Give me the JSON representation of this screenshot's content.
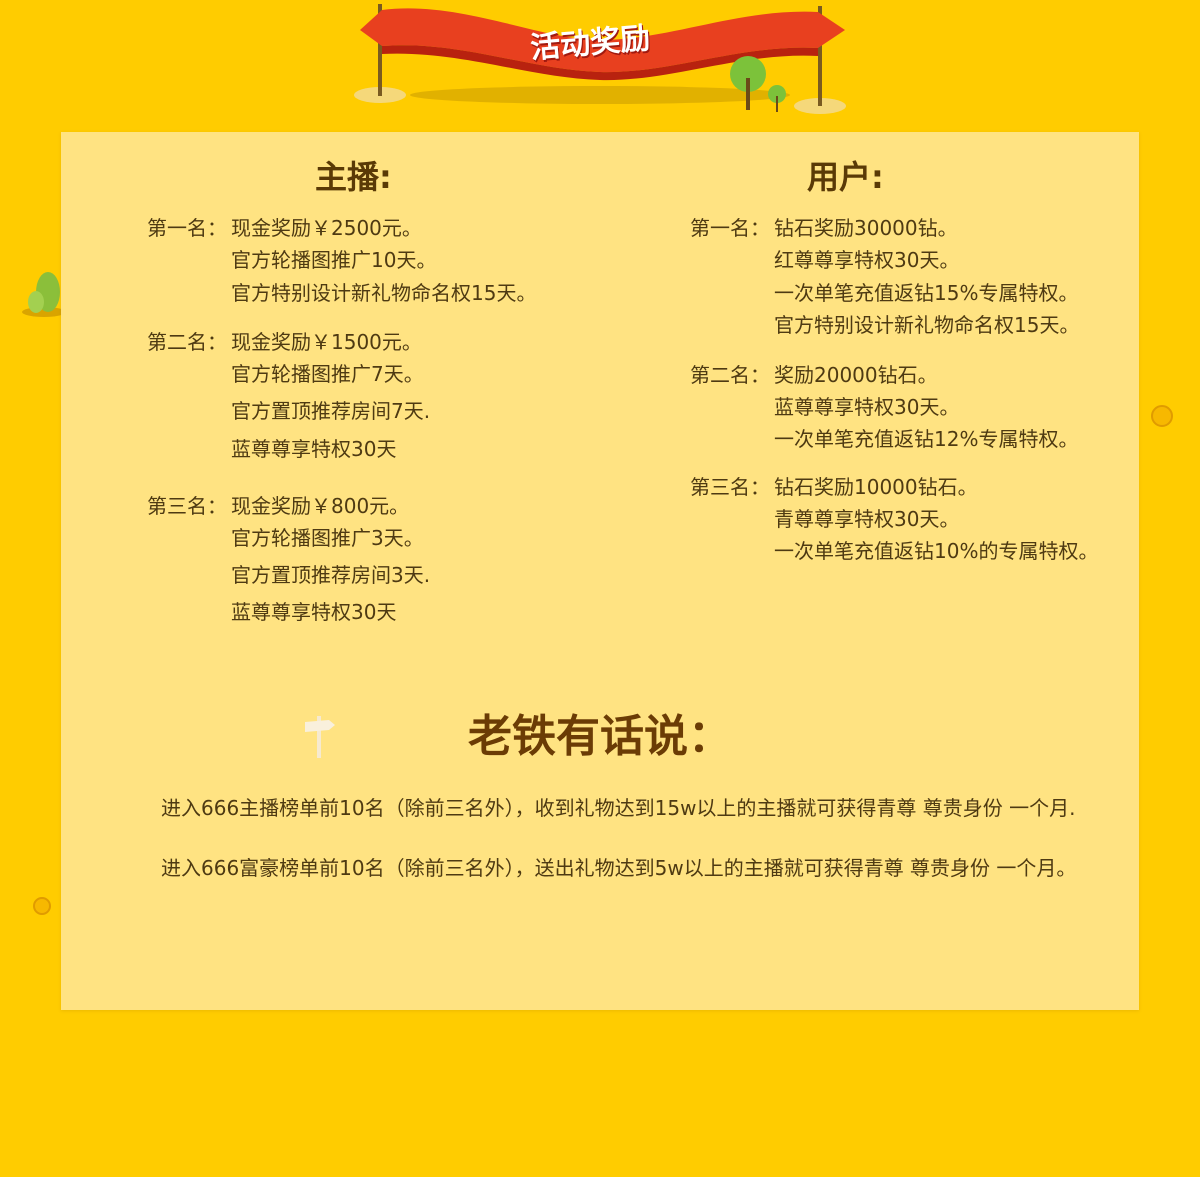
{
  "banner": {
    "title": "活动奖励",
    "colors": {
      "ribbon": "#e8401f",
      "ribbon_dark": "#b8220f",
      "pole": "#7a5a20",
      "tree": "#7cc23a"
    }
  },
  "anchor": {
    "heading": "主播:",
    "ranks": [
      {
        "label": "第一名：",
        "items": [
          "现金奖励￥2500元。",
          "官方轮播图推广10天。",
          "官方特别设计新礼物命名权15天。"
        ]
      },
      {
        "label": "第二名：",
        "items": [
          "现金奖励￥1500元。",
          "官方轮播图推广7天。",
          "官方置顶推荐房间7天.",
          "蓝尊尊享特权30天"
        ]
      },
      {
        "label": "第三名：",
        "items": [
          "现金奖励￥800元。",
          "官方轮播图推广3天。",
          "官方置顶推荐房间3天.",
          "蓝尊尊享特权30天"
        ]
      }
    ]
  },
  "user": {
    "heading": "用户:",
    "ranks": [
      {
        "label": "第一名：",
        "items": [
          "钻石奖励30000钻。",
          "红尊尊享特权30天。",
          "一次单笔充值返钻15%专属特权。",
          "官方特别设计新礼物命名权15天。"
        ]
      },
      {
        "label": "第二名：",
        "items": [
          "奖励20000钻石。",
          "蓝尊尊享特权30天。",
          "一次单笔充值返钻12%专属特权。"
        ]
      },
      {
        "label": "第三名：",
        "items": [
          "钻石奖励10000钻石。",
          "青尊尊享特权30天。",
          "一次单笔充值返钻10%的专属特权。"
        ]
      }
    ]
  },
  "notes": {
    "heading": "老铁有话说：",
    "lines": [
      "进入666主播榜单前10名（除前三名外），收到礼物达到15w以上的主播就可获得青尊 尊贵身份 一个月.",
      "进入666富豪榜单前10名（除前三名外），送出礼物达到5w以上的主播就可获得青尊 尊贵身份 一个月。"
    ]
  },
  "colors": {
    "background": "#ffcc00",
    "panel": "#ffe382",
    "heading": "#5a3a06",
    "text": "#4e3a12"
  }
}
